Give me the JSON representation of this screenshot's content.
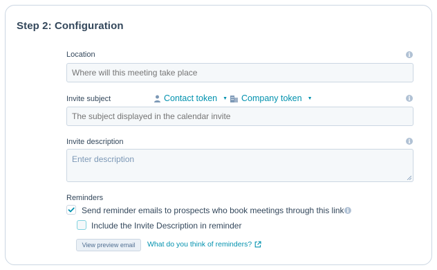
{
  "step": {
    "title": "Step 2: Configuration"
  },
  "location": {
    "label": "Location",
    "placeholder": "Where will this meeting take place"
  },
  "invite_subject": {
    "label": "Invite subject",
    "contact_token": "Contact token",
    "company_token": "Company token",
    "placeholder": "The subject displayed in the calendar invite"
  },
  "invite_description": {
    "label": "Invite description",
    "placeholder": "Enter description"
  },
  "reminders": {
    "label": "Reminders",
    "send_reminder_label": "Send reminder emails to prospects who book meetings through this link",
    "send_reminder_checked": true,
    "include_description_label": "Include the Invite Description in reminder",
    "include_description_checked": false,
    "preview_button": "View preview email",
    "feedback_link": "What do you think of reminders?"
  },
  "colors": {
    "accent_link": "#0091ae",
    "text_primary": "#33475b",
    "input_bg": "#f5f8fa",
    "border": "#cbd6e2"
  },
  "icons": [
    "info-icon",
    "person-icon",
    "building-icon",
    "chevron-down-icon",
    "checkmark-icon",
    "external-link-icon"
  ]
}
